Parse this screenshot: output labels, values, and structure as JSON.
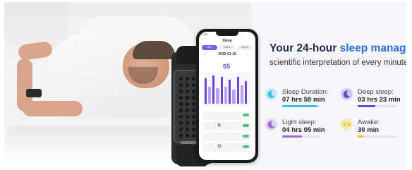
{
  "headline": {
    "prefix": "Your 24-hour ",
    "accent": "sleep manager",
    "suffix": ","
  },
  "subline": "scientific interpretation of every minute!",
  "stats": [
    {
      "label": "Sleep Duration:",
      "value": "07 hrs 58 min",
      "color": "#37c6e6",
      "icon": "moon-icon",
      "fill": 0.9
    },
    {
      "label": "Deep sleep:",
      "value": "03 hrs 23 min",
      "color": "#6a44d4",
      "icon": "moon-icon",
      "fill": 0.45
    },
    {
      "label": "Light sleep:",
      "value": "04 hrs 05 min",
      "color": "#9a6ad6",
      "icon": "moon-icon",
      "fill": 0.5
    },
    {
      "label": "Awake:",
      "value": "30 min",
      "color": "#f2c200",
      "icon": "eye-icon",
      "fill": 0.15
    }
  ],
  "phone": {
    "time": "9:42",
    "title": "Sleep",
    "tabs": [
      "Day",
      "Week",
      "Month"
    ],
    "date": "2025-01-16",
    "big_value": "65",
    "rows": [
      "",
      "11",
      "",
      "72"
    ]
  }
}
